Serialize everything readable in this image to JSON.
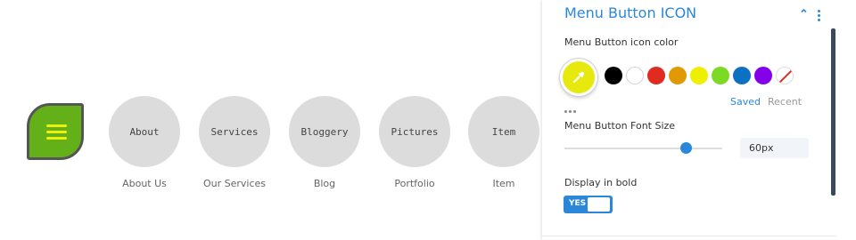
{
  "preview": {
    "menu_button_color": "#64b018",
    "menu_icon_color": "#eef00c",
    "items": [
      {
        "title": "About",
        "caption": "About Us"
      },
      {
        "title": "Services",
        "caption": "Our Services"
      },
      {
        "title": "Bloggery",
        "caption": "Blog"
      },
      {
        "title": "Pictures",
        "caption": "Portfolio"
      },
      {
        "title": "Item",
        "caption": "Item"
      }
    ]
  },
  "panel": {
    "title": "Menu Button ICON",
    "collapse_icon": "chevron-up-icon",
    "options_icon": "more-vertical-icon",
    "icon_color": {
      "label": "Menu Button icon color",
      "selected": "#e7e90e",
      "swatches": [
        "#000000",
        "#ffffff",
        "#e02b20",
        "#e09900",
        "#edf000",
        "#7cda24",
        "#0c71c3",
        "#8300e9",
        "none"
      ],
      "saved_label": "Saved",
      "recent_label": "Recent"
    },
    "font_size": {
      "label": "Menu Button Font Size",
      "value": "60px",
      "slider_fraction": 0.77
    },
    "bold": {
      "label": "Display in bold",
      "state": "YES"
    }
  },
  "colors": {
    "accent": "#2b87da"
  }
}
